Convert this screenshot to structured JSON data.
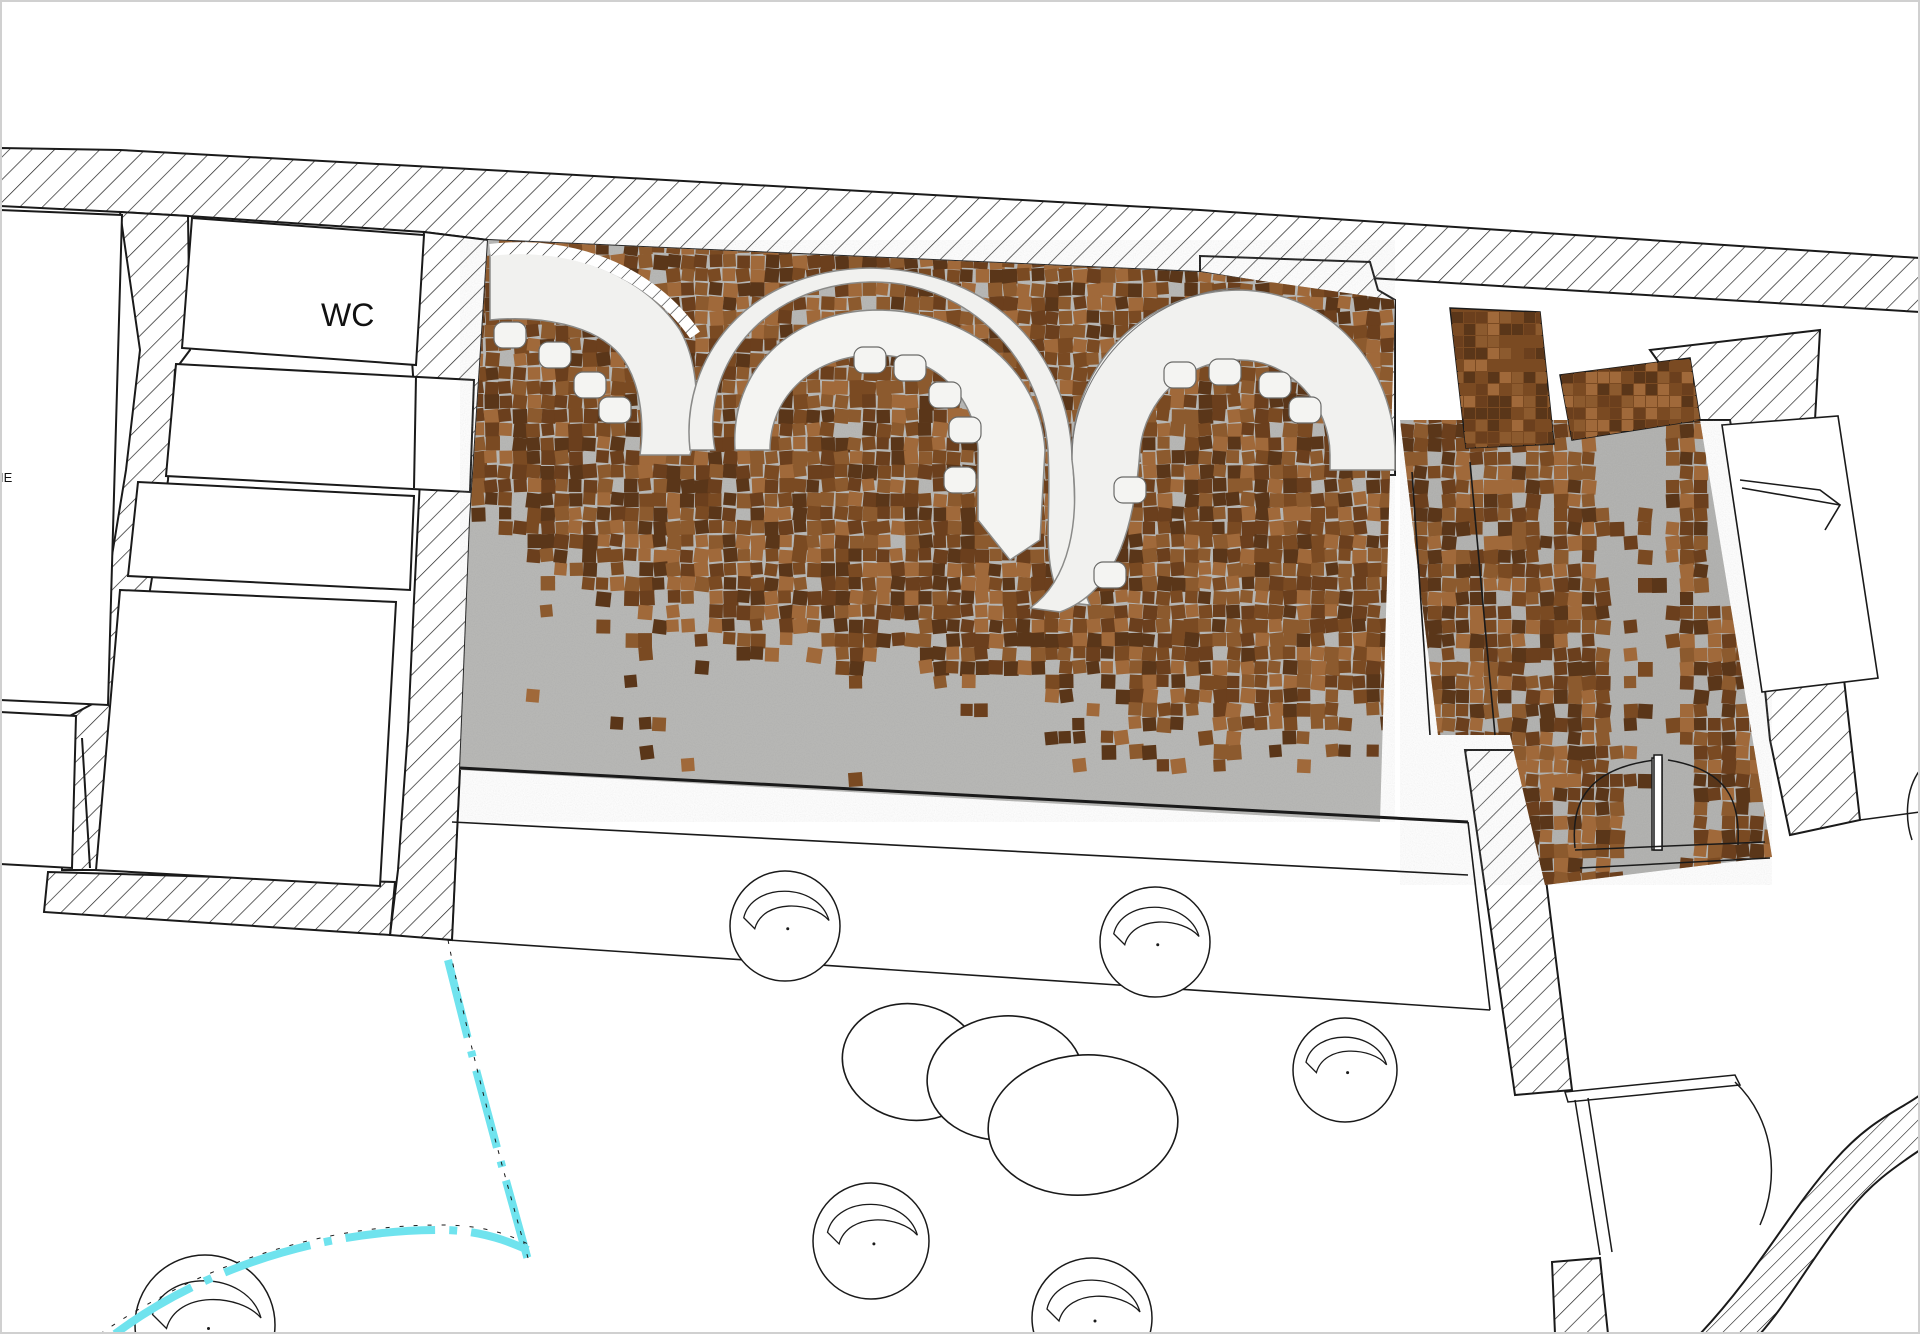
{
  "plan": {
    "labels": {
      "wc": "WC",
      "cut_off": "IE"
    },
    "colors": {
      "background": "#ffffff",
      "wall_line": "#1a1a1a",
      "hatch": "#222222",
      "concrete": "#b8b8b6",
      "concrete_dark": "#a7a7a5",
      "tile_dark": "#5a3619",
      "tile_mid": "#7a4a22",
      "tile_light": "#a0693a",
      "seat_white": "#f1f1ef",
      "seat_shadow": "#d7d7d5",
      "glass_cyan": "#6fe3ee"
    },
    "elements": {
      "walls": "hatched-walls",
      "floor": "concrete-floor",
      "mosaic": "copper-tile-mosaic",
      "benches": "curved-white-benches",
      "chairs": "egg-chairs",
      "tables": "oval-tables",
      "glazing": "curved-glass-partition",
      "doors": "door-swings"
    }
  }
}
